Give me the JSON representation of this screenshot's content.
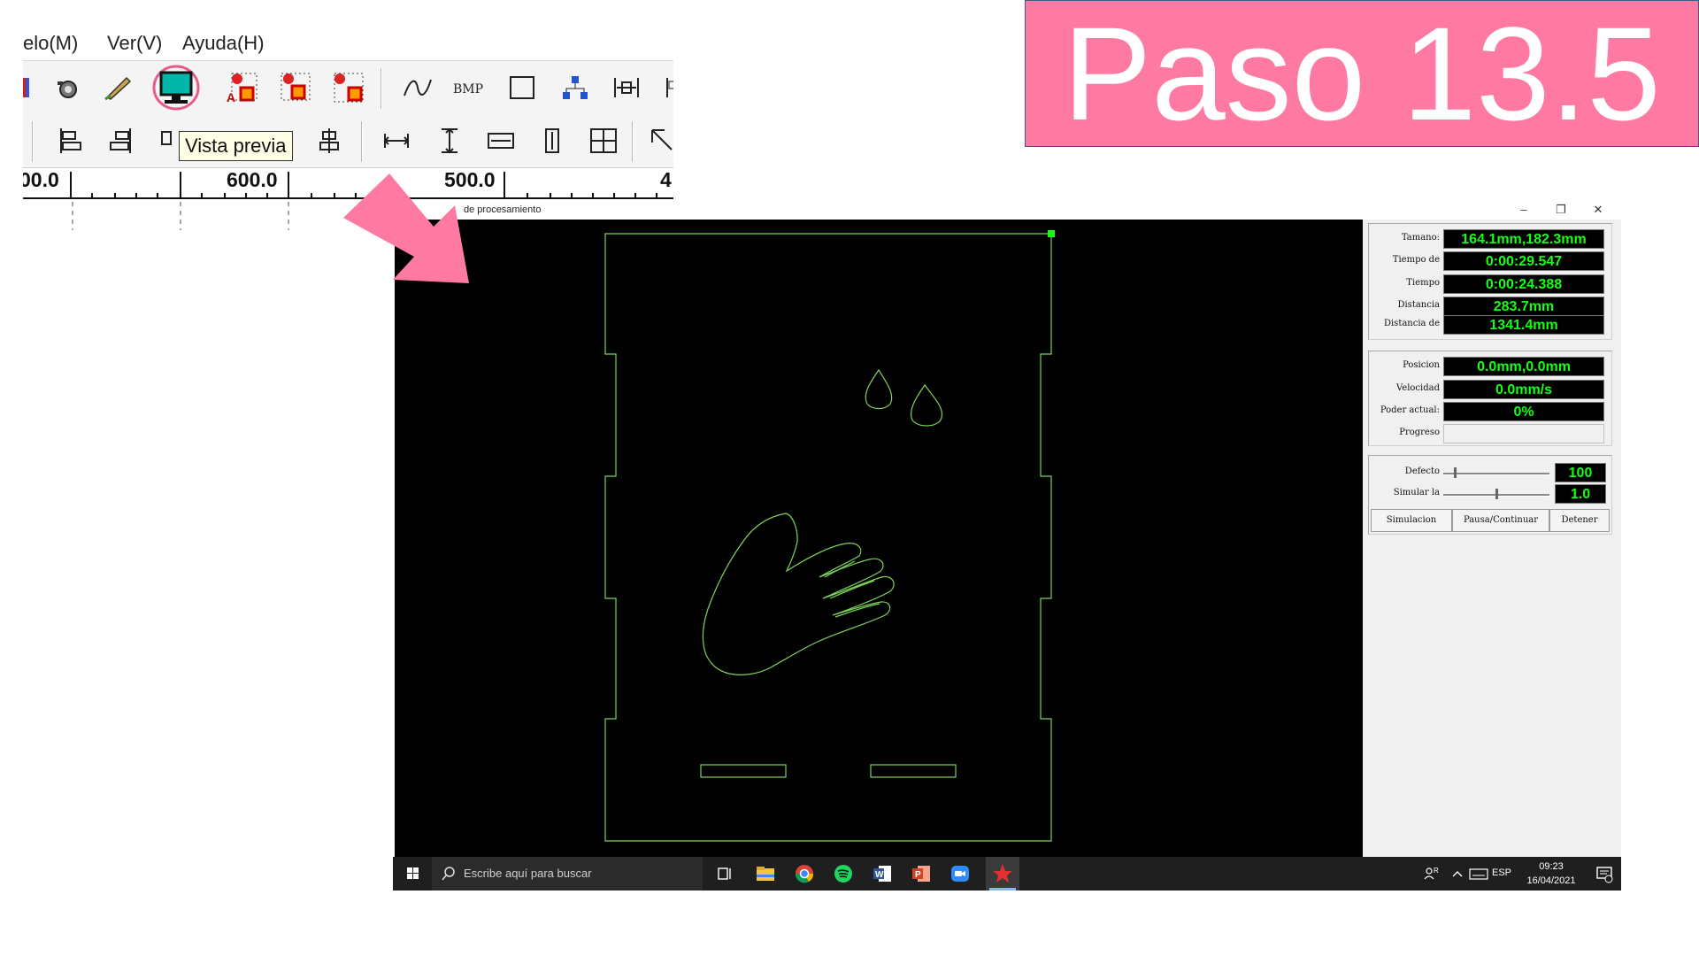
{
  "menu": {
    "items": [
      "elo(M)",
      "Ver(V)",
      "Ayuda(H)"
    ]
  },
  "tooltip": "Vista previa",
  "ruler": {
    "labels": [
      "00.0",
      "600.0",
      "500.0",
      "4"
    ]
  },
  "banner": {
    "text": "Paso 13.5"
  },
  "window": {
    "title": "de procesamiento",
    "controls": {
      "minimize": "–",
      "restore": "❐",
      "close": "✕"
    }
  },
  "panel": {
    "info": [
      {
        "label": "Tamano:",
        "value": "164.1mm,182.3mm"
      },
      {
        "label": "Tiempo de",
        "value": "0:00:29.547"
      },
      {
        "label": "Tiempo",
        "value": "0:00:24.388"
      },
      {
        "label": "Distancia",
        "value": "283.7mm"
      },
      {
        "label": "Distancia de",
        "value": "1341.4mm"
      }
    ],
    "status": [
      {
        "label": "Posicion",
        "value": "0.0mm,0.0mm"
      },
      {
        "label": "Velocidad",
        "value": "0.0mm/s"
      },
      {
        "label": "Poder actual:",
        "value": "0%"
      },
      {
        "label": "Progreso",
        "value": ""
      }
    ],
    "sliders": [
      {
        "label": "Defecto",
        "value": "100",
        "level": 0.1
      },
      {
        "label": "Simular la",
        "value": "1.0",
        "level": 0.5
      }
    ],
    "buttons": [
      "Simulacion",
      "Pausa/Continuar",
      "Detener"
    ]
  },
  "taskbar": {
    "search_placeholder": "Escribe aquí para buscar",
    "lang": "ESP",
    "time": "09:23",
    "date": "16/04/2021"
  },
  "colors": {
    "banner": "#ff7aa2",
    "led": "#14ff14",
    "drawing": "#7fd35a",
    "highlight": "#e85a8c"
  }
}
